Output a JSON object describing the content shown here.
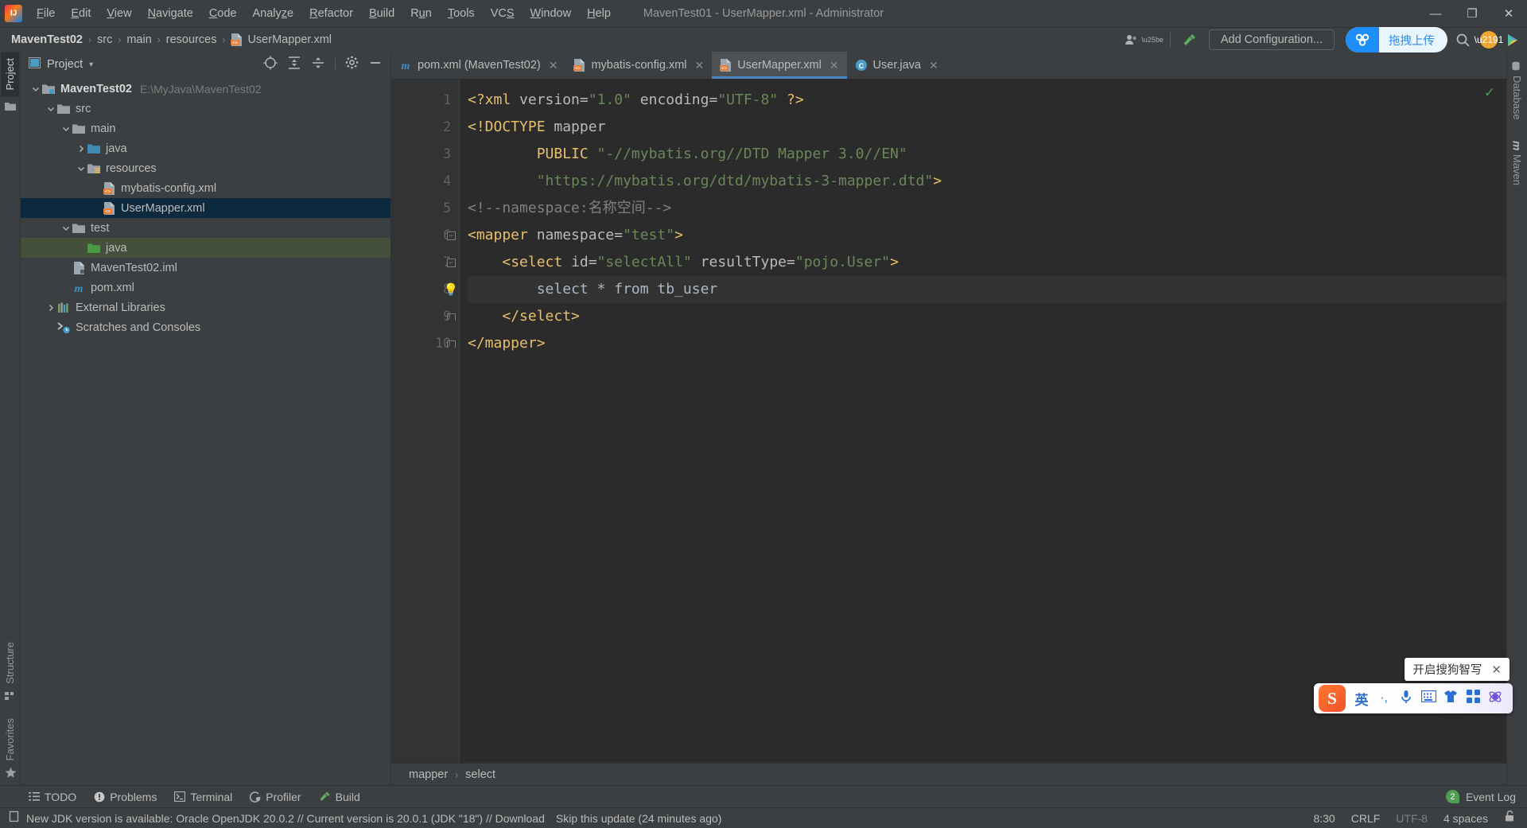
{
  "window": {
    "title": "MavenTest01 - UserMapper.xml - Administrator",
    "minimize": "—",
    "maximize": "❐",
    "close": "✕"
  },
  "menu": {
    "items": [
      {
        "label": "File",
        "accel": "F"
      },
      {
        "label": "Edit",
        "accel": "E"
      },
      {
        "label": "View",
        "accel": "V"
      },
      {
        "label": "Navigate",
        "accel": "N"
      },
      {
        "label": "Code",
        "accel": "C"
      },
      {
        "label": "Analyze",
        "accel": "z"
      },
      {
        "label": "Refactor",
        "accel": "R"
      },
      {
        "label": "Build",
        "accel": "B"
      },
      {
        "label": "Run",
        "accel": "u"
      },
      {
        "label": "Tools",
        "accel": "T"
      },
      {
        "label": "VCS",
        "accel": "S"
      },
      {
        "label": "Window",
        "accel": "W"
      },
      {
        "label": "Help",
        "accel": "H"
      }
    ]
  },
  "navbar": {
    "breadcrumbs": [
      "MavenTest02",
      "src",
      "main",
      "resources",
      "UserMapper.xml"
    ],
    "separator": "›",
    "add_configuration": "Add Configuration...",
    "baidu_upload": "拖拽上传"
  },
  "left_stripe": {
    "project": "Project",
    "structure": "Structure",
    "favorites": "Favorites"
  },
  "right_stripe": {
    "database": "Database",
    "maven": "Maven"
  },
  "project_panel": {
    "title": "Project",
    "chevron": "▾",
    "tree": [
      {
        "label": "MavenTest02",
        "path": "E:\\MyJava\\MavenTest02",
        "indent": 0,
        "arrow": "expanded",
        "icon": "module",
        "bold": true,
        "state": "normal"
      },
      {
        "label": "src",
        "path": "",
        "indent": 1,
        "arrow": "expanded",
        "icon": "folder",
        "bold": false,
        "state": "normal"
      },
      {
        "label": "main",
        "path": "",
        "indent": 2,
        "arrow": "expanded",
        "icon": "folder",
        "bold": false,
        "state": "normal"
      },
      {
        "label": "java",
        "path": "",
        "indent": 3,
        "arrow": "collapsed",
        "icon": "source-folder",
        "bold": false,
        "state": "normal"
      },
      {
        "label": "resources",
        "path": "",
        "indent": 3,
        "arrow": "expanded",
        "icon": "resource-folder",
        "bold": false,
        "state": "normal"
      },
      {
        "label": "mybatis-config.xml",
        "path": "",
        "indent": 4,
        "arrow": "none",
        "icon": "xml-file",
        "bold": false,
        "state": "normal"
      },
      {
        "label": "UserMapper.xml",
        "path": "",
        "indent": 4,
        "arrow": "none",
        "icon": "xml-file",
        "bold": false,
        "state": "selected"
      },
      {
        "label": "test",
        "path": "",
        "indent": 2,
        "arrow": "expanded",
        "icon": "folder",
        "bold": false,
        "state": "normal"
      },
      {
        "label": "java",
        "path": "",
        "indent": 3,
        "arrow": "none",
        "icon": "test-folder",
        "bold": false,
        "state": "highlight"
      },
      {
        "label": "MavenTest02.iml",
        "path": "",
        "indent": 2,
        "arrow": "none",
        "icon": "iml-file",
        "bold": false,
        "state": "normal"
      },
      {
        "label": "pom.xml",
        "path": "",
        "indent": 2,
        "arrow": "none",
        "icon": "maven-file",
        "bold": false,
        "state": "normal"
      },
      {
        "label": "External Libraries",
        "path": "",
        "indent": 1,
        "arrow": "collapsed",
        "icon": "libraries",
        "bold": false,
        "state": "normal"
      },
      {
        "label": "Scratches and Consoles",
        "path": "",
        "indent": 1,
        "arrow": "none",
        "icon": "scratches",
        "bold": false,
        "state": "normal"
      }
    ]
  },
  "editor_tabs": [
    {
      "label": "pom.xml (MavenTest02)",
      "icon": "maven-file",
      "active": false,
      "close": "✕"
    },
    {
      "label": "mybatis-config.xml",
      "icon": "xml-file",
      "active": false,
      "close": "✕"
    },
    {
      "label": "UserMapper.xml",
      "icon": "xml-file",
      "active": true,
      "close": "✕"
    },
    {
      "label": "User.java",
      "icon": "java-class",
      "active": false,
      "close": "✕"
    }
  ],
  "editor": {
    "line_numbers": [
      "1",
      "2",
      "3",
      "4",
      "5",
      "6",
      "7",
      "8",
      "9",
      "10"
    ],
    "lines": [
      {
        "n": "1",
        "fold": "none",
        "highlight": false,
        "tokens": [
          {
            "t": "<?xml ",
            "c": "tag"
          },
          {
            "t": "version=",
            "c": "attr"
          },
          {
            "t": "\"1.0\"",
            "c": "str"
          },
          {
            "t": " ",
            "c": "plain"
          },
          {
            "t": "encoding=",
            "c": "attr"
          },
          {
            "t": "\"UTF-8\"",
            "c": "str"
          },
          {
            "t": " ",
            "c": "plain"
          },
          {
            "t": "?>",
            "c": "tag"
          }
        ]
      },
      {
        "n": "2",
        "fold": "none",
        "highlight": false,
        "tokens": [
          {
            "t": "<!DOCTYPE",
            "c": "tag"
          },
          {
            "t": " mapper",
            "c": "attr"
          }
        ]
      },
      {
        "n": "3",
        "fold": "none",
        "highlight": false,
        "tokens": [
          {
            "t": "        ",
            "c": "plain"
          },
          {
            "t": "PUBLIC",
            "c": "tag"
          },
          {
            "t": " ",
            "c": "plain"
          },
          {
            "t": "\"-//mybatis.org//DTD Mapper 3.0//EN\"",
            "c": "str"
          }
        ]
      },
      {
        "n": "4",
        "fold": "none",
        "highlight": false,
        "tokens": [
          {
            "t": "        ",
            "c": "plain"
          },
          {
            "t": "\"https://mybatis.org/dtd/mybatis-3-mapper.dtd\"",
            "c": "str"
          },
          {
            "t": ">",
            "c": "tag"
          }
        ]
      },
      {
        "n": "5",
        "fold": "none",
        "highlight": false,
        "tokens": [
          {
            "t": "<!--namespace:名称空间-->",
            "c": "cmt"
          }
        ]
      },
      {
        "n": "6",
        "fold": "open",
        "highlight": false,
        "tokens": [
          {
            "t": "<mapper ",
            "c": "tag"
          },
          {
            "t": "namespace=",
            "c": "attr"
          },
          {
            "t": "\"test\"",
            "c": "str"
          },
          {
            "t": ">",
            "c": "tag"
          }
        ]
      },
      {
        "n": "7",
        "fold": "open",
        "highlight": false,
        "tokens": [
          {
            "t": "    ",
            "c": "plain"
          },
          {
            "t": "<select ",
            "c": "tag"
          },
          {
            "t": "id=",
            "c": "attr"
          },
          {
            "t": "\"selectAll\"",
            "c": "str"
          },
          {
            "t": " ",
            "c": "plain"
          },
          {
            "t": "resultType=",
            "c": "attr"
          },
          {
            "t": "\"pojo.User\"",
            "c": "str"
          },
          {
            "t": ">",
            "c": "tag"
          }
        ]
      },
      {
        "n": "8",
        "fold": "bulb",
        "highlight": true,
        "tokens": [
          {
            "t": "        select * from tb_user",
            "c": "plain"
          }
        ]
      },
      {
        "n": "9",
        "fold": "end",
        "highlight": false,
        "tokens": [
          {
            "t": "    ",
            "c": "plain"
          },
          {
            "t": "</select>",
            "c": "tag"
          }
        ]
      },
      {
        "n": "10",
        "fold": "end",
        "highlight": false,
        "tokens": [
          {
            "t": "</mapper>",
            "c": "tag"
          }
        ]
      }
    ],
    "inspection_ok": "✓"
  },
  "editor_breadcrumb": {
    "items": [
      "mapper",
      "select"
    ],
    "separator": "›"
  },
  "bottom_toolbar": {
    "items": [
      {
        "label": "TODO",
        "icon": "todo-icon"
      },
      {
        "label": "Problems",
        "icon": "problems-icon"
      },
      {
        "label": "Terminal",
        "icon": "terminal-icon"
      },
      {
        "label": "Profiler",
        "icon": "profiler-icon"
      },
      {
        "label": "Build",
        "icon": "build-icon"
      }
    ],
    "event_log": "Event Log",
    "event_count": "2"
  },
  "statusbar": {
    "message": "New JDK version is available: Oracle OpenJDK 20.0.2 // Current version is 20.0.1 (JDK \"18\") // Download",
    "skip": "Skip this update (24 minutes ago)",
    "caret": "8:30",
    "line_separator": "CRLF",
    "encoding": "UTF-8",
    "indent": "4 spaces",
    "lock": "🔓"
  },
  "sogou_ime": {
    "logo": "S",
    "mode": "英",
    "punctuation": "·,",
    "icons": [
      "mic-icon",
      "keyboard-icon",
      "skin-icon",
      "apps-icon",
      "smart-write-icon"
    ],
    "tooltip": "开启搜狗智写",
    "tooltip_close": "✕"
  },
  "colors": {
    "accent": "#4a88c7",
    "selection": "#0d293e",
    "tree_highlight": "#44503c",
    "editor_bg": "#2b2b2b",
    "panel_bg": "#3c3f41",
    "baidu_blue": "#1e8ffa",
    "ok_green": "#499c54"
  }
}
